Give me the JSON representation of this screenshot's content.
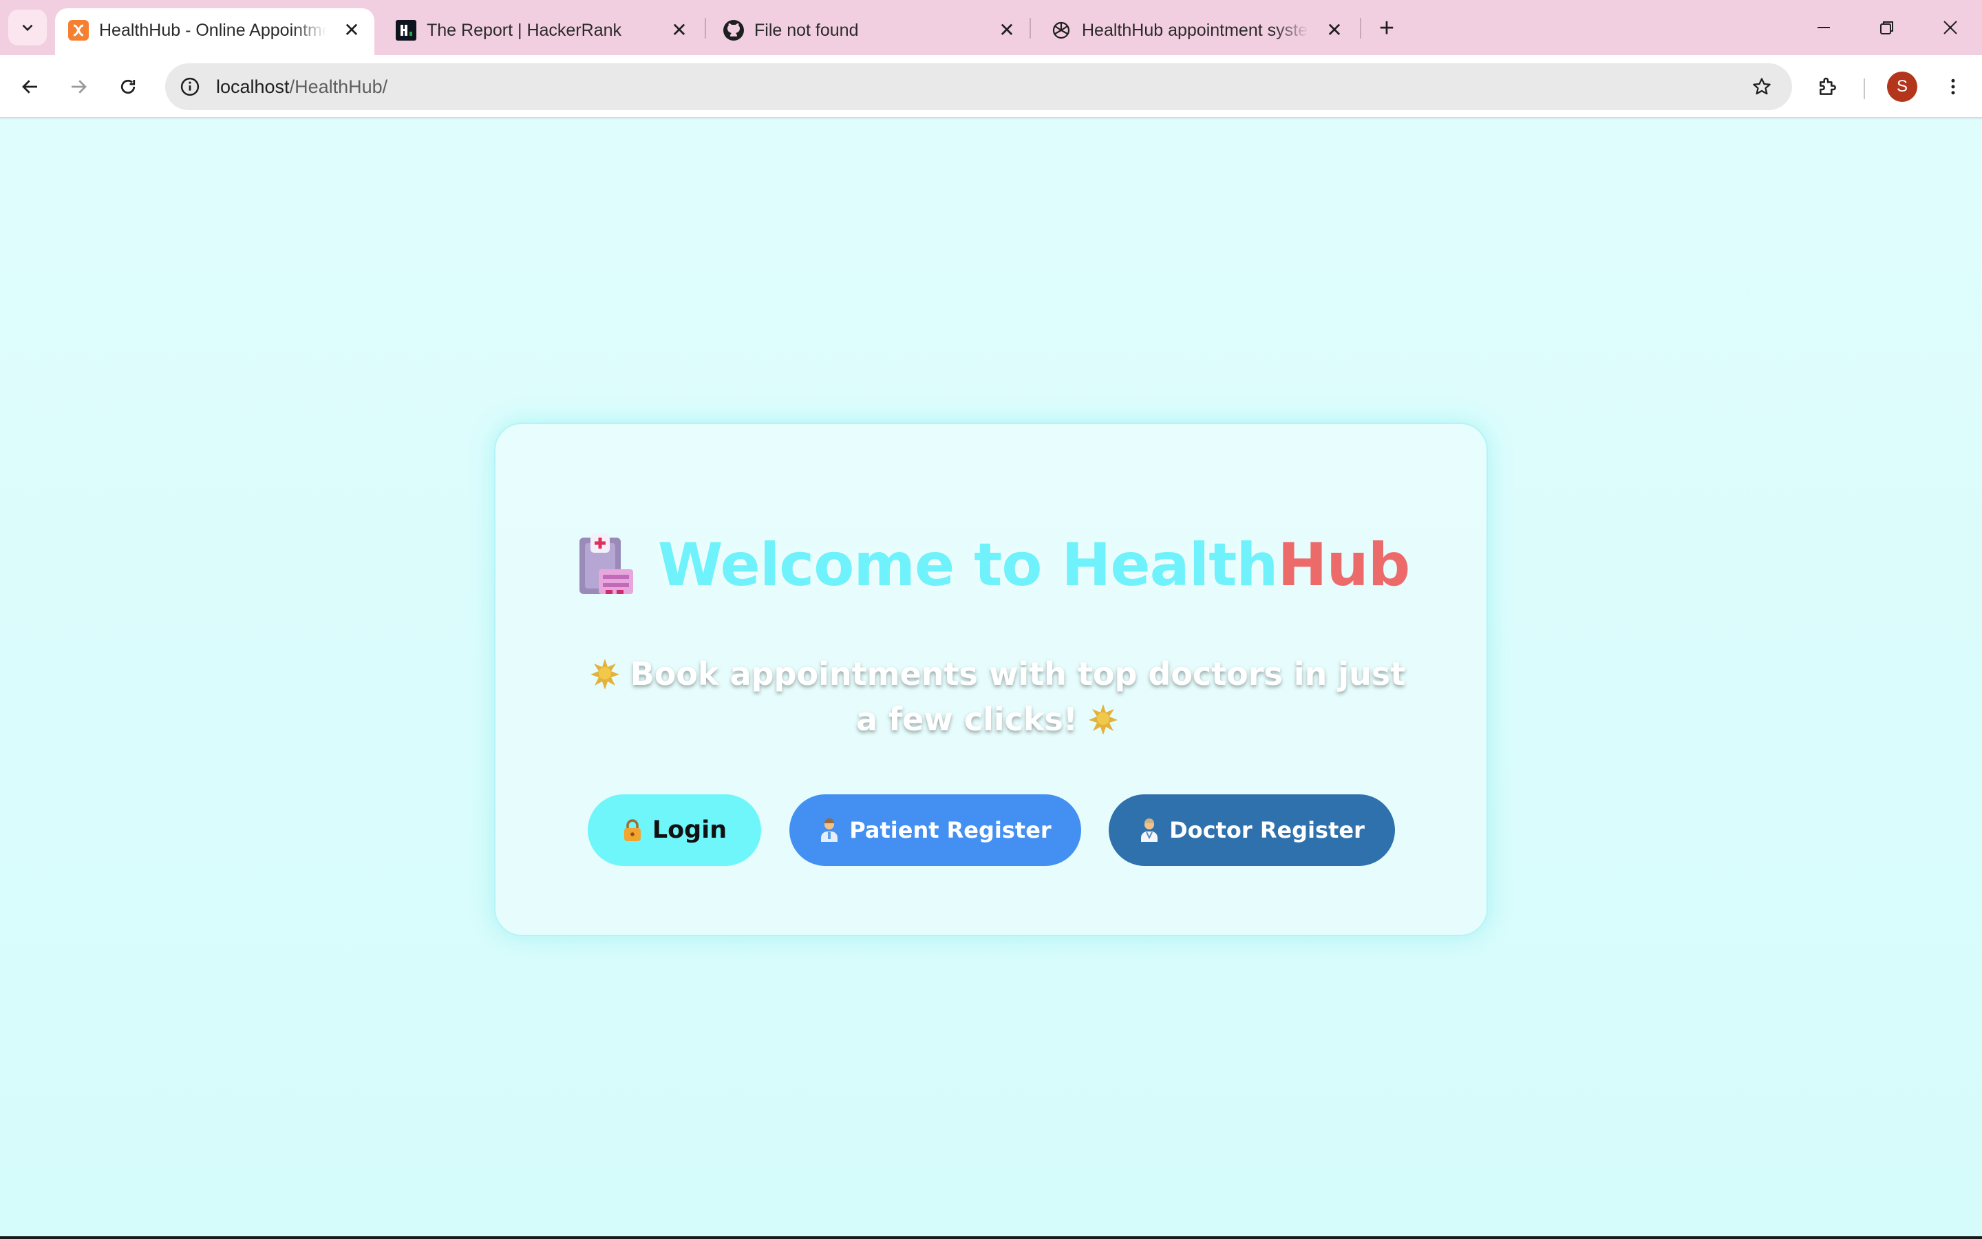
{
  "browser": {
    "tabs": [
      {
        "title": "HealthHub - Online Appointment",
        "favicon": "xampp-icon",
        "active": true
      },
      {
        "title": "The Report | HackerRank",
        "favicon": "hackerrank-icon",
        "active": false
      },
      {
        "title": "File not found",
        "favicon": "github-icon",
        "active": false
      },
      {
        "title": "HealthHub appointment system",
        "favicon": "chatgpt-icon",
        "active": false
      }
    ],
    "url_host": "localhost",
    "url_path": "/HealthHub/",
    "profile_initial": "S"
  },
  "hero": {
    "title_main": "Welcome to Health",
    "title_accent": "Hub",
    "subtitle": "Book appointments with top doctors in just a few clicks!",
    "icon": "hospital-icon"
  },
  "actions": {
    "login": "Login",
    "patient_register": "Patient Register",
    "doctor_register": "Doctor Register"
  },
  "colors": {
    "page_bg": "#d8fafa",
    "title_cyan": "#6ff2fb",
    "title_red": "#ec6a6a",
    "login_bg": "#6ef6fb",
    "patient_bg": "#4390f2",
    "doctor_bg": "#2f71ad",
    "tabstrip_bg": "#f2cfe0"
  }
}
